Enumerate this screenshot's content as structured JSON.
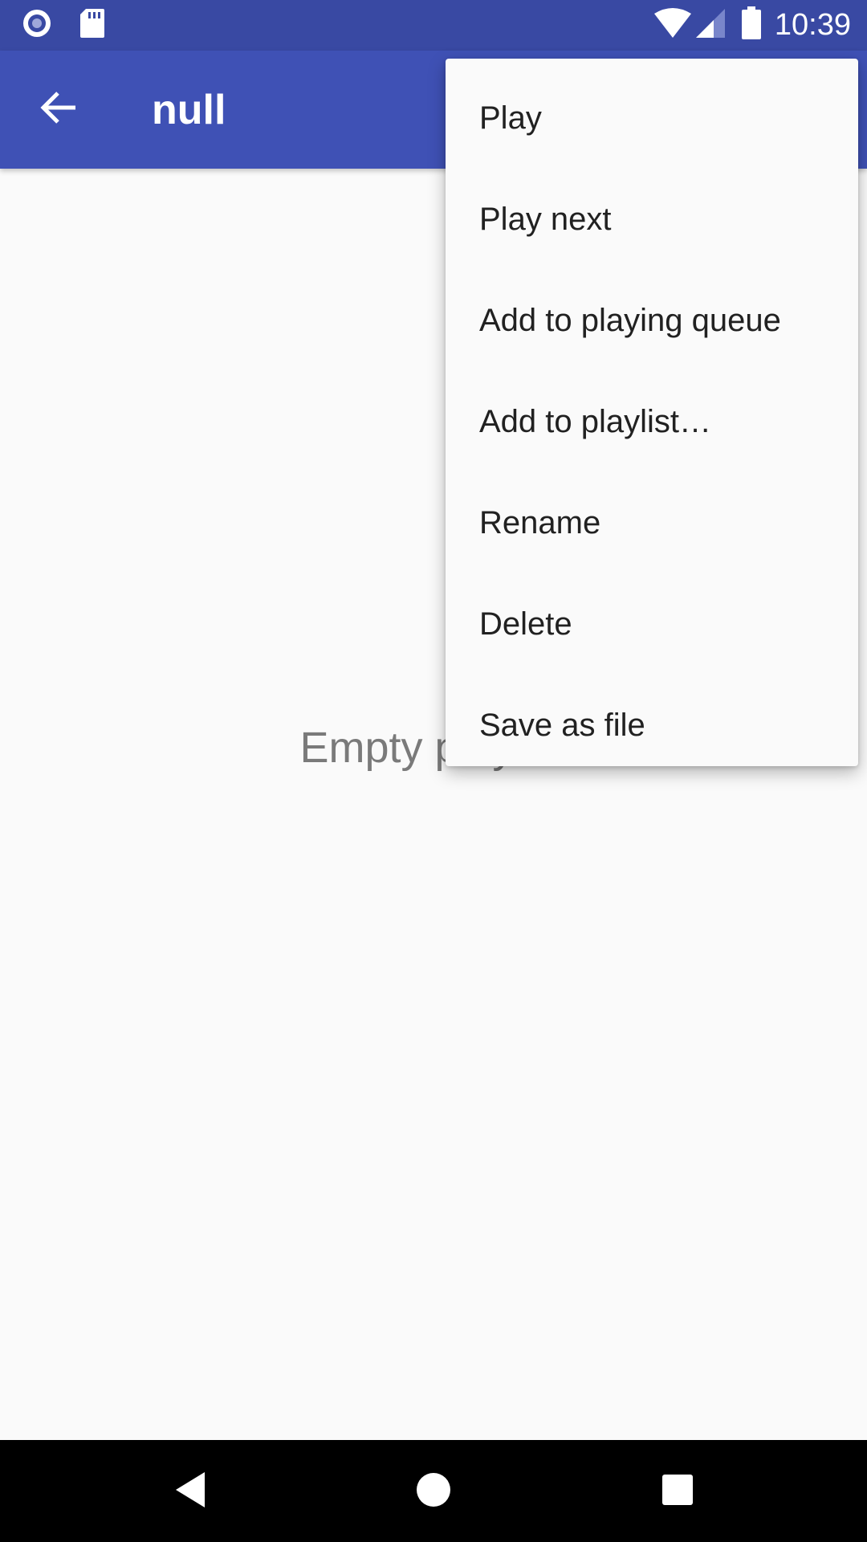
{
  "status_bar": {
    "time": "10:39",
    "left_icons": [
      "notification-circle-icon",
      "sd-card-icon"
    ],
    "right_icons": [
      "wifi-icon",
      "signal-icon",
      "battery-icon"
    ],
    "color": "#3949a3"
  },
  "app_bar": {
    "title": "null",
    "color": "#3f51b5"
  },
  "main": {
    "empty_text": "Empty playlist"
  },
  "menu": {
    "items": [
      {
        "label": "Play"
      },
      {
        "label": "Play next"
      },
      {
        "label": "Add to playing queue"
      },
      {
        "label": "Add to playlist…"
      },
      {
        "label": "Rename"
      },
      {
        "label": "Delete"
      },
      {
        "label": "Save as file"
      }
    ]
  },
  "nav_bar": {
    "buttons": [
      "back-triangle-icon",
      "home-circle-icon",
      "recents-square-icon"
    ]
  }
}
